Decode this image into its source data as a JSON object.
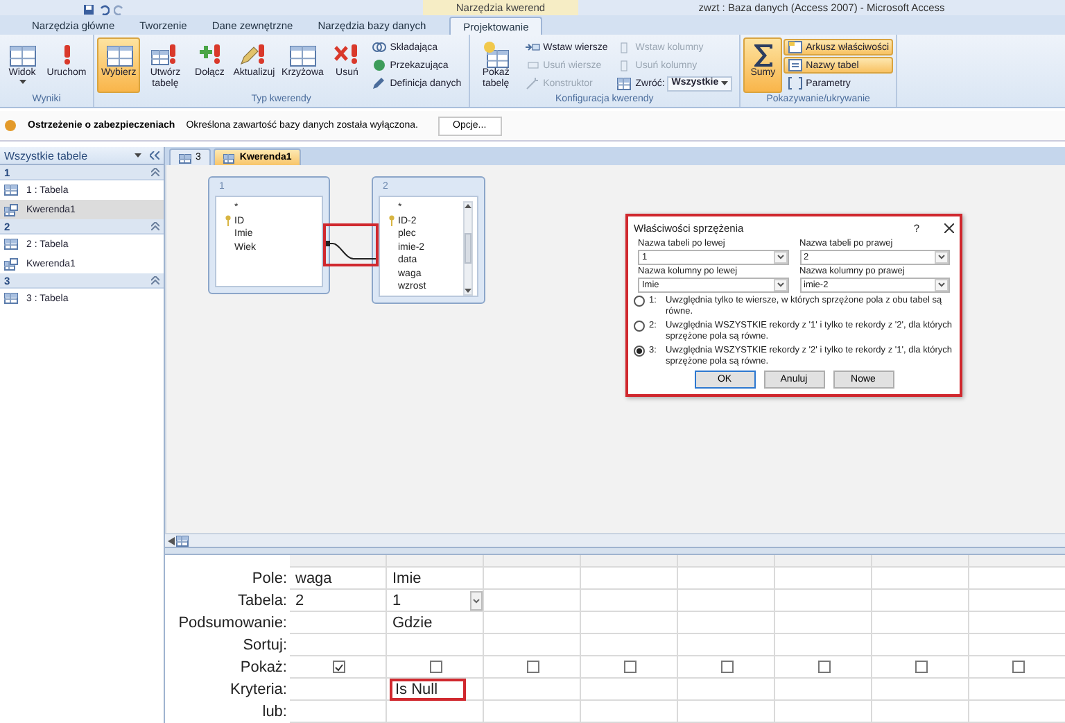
{
  "window": {
    "title": "zwzt : Baza danych (Access 2007) - Microsoft Access",
    "context_tab_group": "Narzędzia kwerend"
  },
  "tabs": [
    {
      "label": "Narzędzia główne",
      "selected": false
    },
    {
      "label": "Tworzenie",
      "selected": false
    },
    {
      "label": "Dane zewnętrzne",
      "selected": false
    },
    {
      "label": "Narzędzia bazy danych",
      "selected": false
    },
    {
      "label": "Projektowanie",
      "selected": true
    }
  ],
  "ribbon": {
    "groups": [
      {
        "label": "Wyniki",
        "items": [
          {
            "label": "Widok",
            "kind": "large",
            "menu": true,
            "selected": false,
            "disabled": false
          },
          {
            "label": "Uruchom",
            "kind": "large",
            "selected": false,
            "disabled": false
          }
        ]
      },
      {
        "label": "Typ kwerendy",
        "items": [
          {
            "label": "Wybierz",
            "kind": "large",
            "selected": true,
            "disabled": false
          },
          {
            "label": "Utwórz tabelę",
            "kind": "large",
            "selected": false,
            "disabled": false
          },
          {
            "label": "Dołącz",
            "kind": "large",
            "selected": false,
            "disabled": false
          },
          {
            "label": "Aktualizuj",
            "kind": "large",
            "selected": false,
            "disabled": false
          },
          {
            "label": "Krzyżowa",
            "kind": "large",
            "selected": false,
            "disabled": false
          },
          {
            "label": "Usuń",
            "kind": "large",
            "selected": false,
            "disabled": false
          },
          {
            "label": "Składająca",
            "kind": "small",
            "selected": false,
            "disabled": false
          },
          {
            "label": "Przekazująca",
            "kind": "small",
            "selected": false,
            "disabled": false
          },
          {
            "label": "Definicja danych",
            "kind": "small",
            "selected": false,
            "disabled": false
          }
        ]
      },
      {
        "label": "Konfiguracja kwerendy",
        "items": [
          {
            "label": "Pokaż tabelę",
            "kind": "large",
            "selected": false,
            "disabled": false
          },
          {
            "label": "Wstaw wiersze",
            "kind": "small",
            "selected": false,
            "disabled": false
          },
          {
            "label": "Usuń wiersze",
            "kind": "small",
            "selected": false,
            "disabled": true
          },
          {
            "label": "Konstruktor",
            "kind": "small",
            "selected": false,
            "disabled": true
          },
          {
            "label": "Wstaw kolumny",
            "kind": "small",
            "selected": false,
            "disabled": true
          },
          {
            "label": "Usuń kolumny",
            "kind": "small",
            "selected": false,
            "disabled": true
          },
          {
            "label": "Zwróć:",
            "kind": "dropdown",
            "value": "Wszystkie",
            "selected": false,
            "disabled": false
          }
        ]
      },
      {
        "label": "Pokazywanie/ukrywanie",
        "items": [
          {
            "label": "Sumy",
            "kind": "large",
            "selected": true,
            "disabled": false
          },
          {
            "label": "Arkusz właściwości",
            "kind": "small",
            "selected": true,
            "disabled": false
          },
          {
            "label": "Nazwy tabel",
            "kind": "small",
            "selected": true,
            "disabled": false
          },
          {
            "label": "Parametry",
            "kind": "small",
            "selected": false,
            "disabled": false
          }
        ]
      }
    ]
  },
  "security_bar": {
    "title": "Ostrzeżenie o zabezpieczeniach",
    "message": "Określona zawartość bazy danych została wyłączona.",
    "button": "Opcje..."
  },
  "nav_pane": {
    "header": "Wszystkie tabele",
    "groups": [
      {
        "label": "1",
        "items": [
          {
            "label": "1 : Tabela",
            "kind": "table",
            "selected": false
          },
          {
            "label": "Kwerenda1",
            "kind": "query",
            "selected": true
          }
        ]
      },
      {
        "label": "2",
        "items": [
          {
            "label": "2 : Tabela",
            "kind": "table",
            "selected": false
          },
          {
            "label": "Kwerenda1",
            "kind": "query",
            "selected": false
          }
        ]
      },
      {
        "label": "3",
        "items": [
          {
            "label": "3 : Tabela",
            "kind": "table",
            "selected": false
          }
        ]
      }
    ]
  },
  "document_tabs": [
    {
      "label": "3",
      "selected": false
    },
    {
      "label": "Kwerenda1",
      "selected": true
    }
  ],
  "design": {
    "tables": [
      {
        "title": "1",
        "scrollbar": false,
        "fields": [
          {
            "name": "*",
            "key": false
          },
          {
            "name": "ID",
            "key": true
          },
          {
            "name": "Imie",
            "key": false
          },
          {
            "name": "Wiek",
            "key": false
          }
        ]
      },
      {
        "title": "2",
        "scrollbar": true,
        "fields": [
          {
            "name": "*",
            "key": false
          },
          {
            "name": "ID-2",
            "key": true
          },
          {
            "name": "plec",
            "key": false
          },
          {
            "name": "imie-2",
            "key": false
          },
          {
            "name": "data",
            "key": false
          },
          {
            "name": "waga",
            "key": false
          },
          {
            "name": "wzrost",
            "key": false
          }
        ]
      }
    ],
    "join": {
      "highlighted": true
    }
  },
  "dialog": {
    "title": "Właściwości sprzężenia",
    "help": "?",
    "highlighted": true,
    "fields": [
      {
        "label": "Nazwa tabeli po lewej",
        "value": "1"
      },
      {
        "label": "Nazwa tabeli po prawej",
        "value": "2"
      },
      {
        "label": "Nazwa kolumny po lewej",
        "value": "Imie"
      },
      {
        "label": "Nazwa kolumny po prawej",
        "value": "imie-2"
      }
    ],
    "options": [
      {
        "number": "1:",
        "text": "Uwzględnia tylko te wiersze, w których sprzężone pola z obu tabel są równe.",
        "selected": false
      },
      {
        "number": "2:",
        "text": "Uwzględnia WSZYSTKIE rekordy z '1' i tylko te rekordy z '2', dla których sprzężone pola są równe.",
        "selected": false
      },
      {
        "number": "3:",
        "text": "Uwzględnia WSZYSTKIE rekordy z '2' i tylko te rekordy z '1', dla których sprzężone pola są równe.",
        "selected": true
      }
    ],
    "buttons": [
      {
        "label": "OK",
        "default": true
      },
      {
        "label": "Anuluj",
        "default": false
      },
      {
        "label": "Nowe",
        "default": false
      }
    ]
  },
  "grid": {
    "row_labels": [
      "Pole:",
      "Tabela:",
      "Podsumowanie:",
      "Sortuj:",
      "Pokaż:",
      "Kryteria:",
      "lub:"
    ],
    "columns": [
      {
        "field": "waga",
        "table": "2",
        "show": true,
        "active": false,
        "highlighted": false
      },
      {
        "field": "Imie",
        "table": "1",
        "total": "Gdzie",
        "show": false,
        "criteria": "Is Null",
        "active": true,
        "highlighted": true
      },
      {
        "show": false,
        "active": false,
        "highlighted": false
      },
      {
        "show": false,
        "active": false,
        "highlighted": false
      },
      {
        "show": false,
        "active": false,
        "highlighted": false
      },
      {
        "show": false,
        "active": false,
        "highlighted": false
      },
      {
        "show": false,
        "active": false,
        "highlighted": false
      },
      {
        "show": false,
        "active": false,
        "highlighted": false
      }
    ]
  }
}
